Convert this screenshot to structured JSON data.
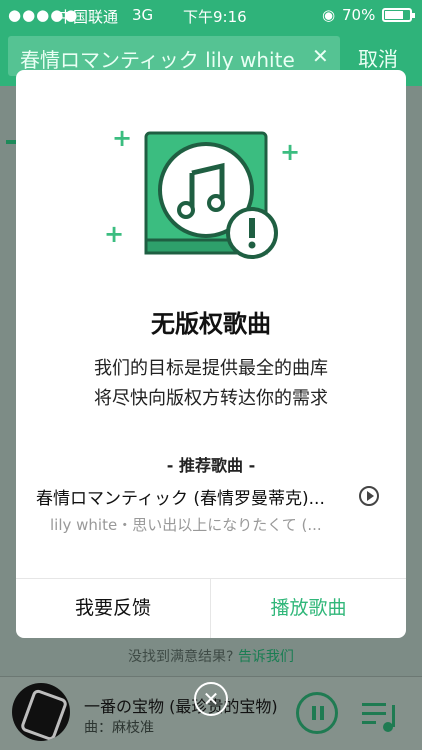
{
  "status_bar": {
    "signal": "●●●●●",
    "carrier": "中国联通",
    "network": "3G",
    "time": "下午9:16",
    "battery_percent": "70%"
  },
  "search": {
    "query": "春情ロマンティック lily white",
    "cancel_label": "取消"
  },
  "dialog": {
    "title": "无版权歌曲",
    "line1": "我们的目标是提供最全的曲库",
    "line2": "将尽快向版权方转达你的需求",
    "recommend_heading": "- 推荐歌曲 -",
    "rec_song": "春情ロマンティック (春情罗曼蒂克)...",
    "rec_sub": "lily white・思い出以上になりたくて (...",
    "feedback_label": "我要反馈",
    "play_label": "播放歌曲"
  },
  "no_result": {
    "prefix": "没找到满意结果?",
    "link": "告诉我们"
  },
  "player": {
    "title": "一番の宝物 (最珍贵的宝物)",
    "artist": "曲：麻枝准"
  },
  "colors": {
    "brand_green": "#31b77a",
    "dark_green": "#1f7b52"
  }
}
